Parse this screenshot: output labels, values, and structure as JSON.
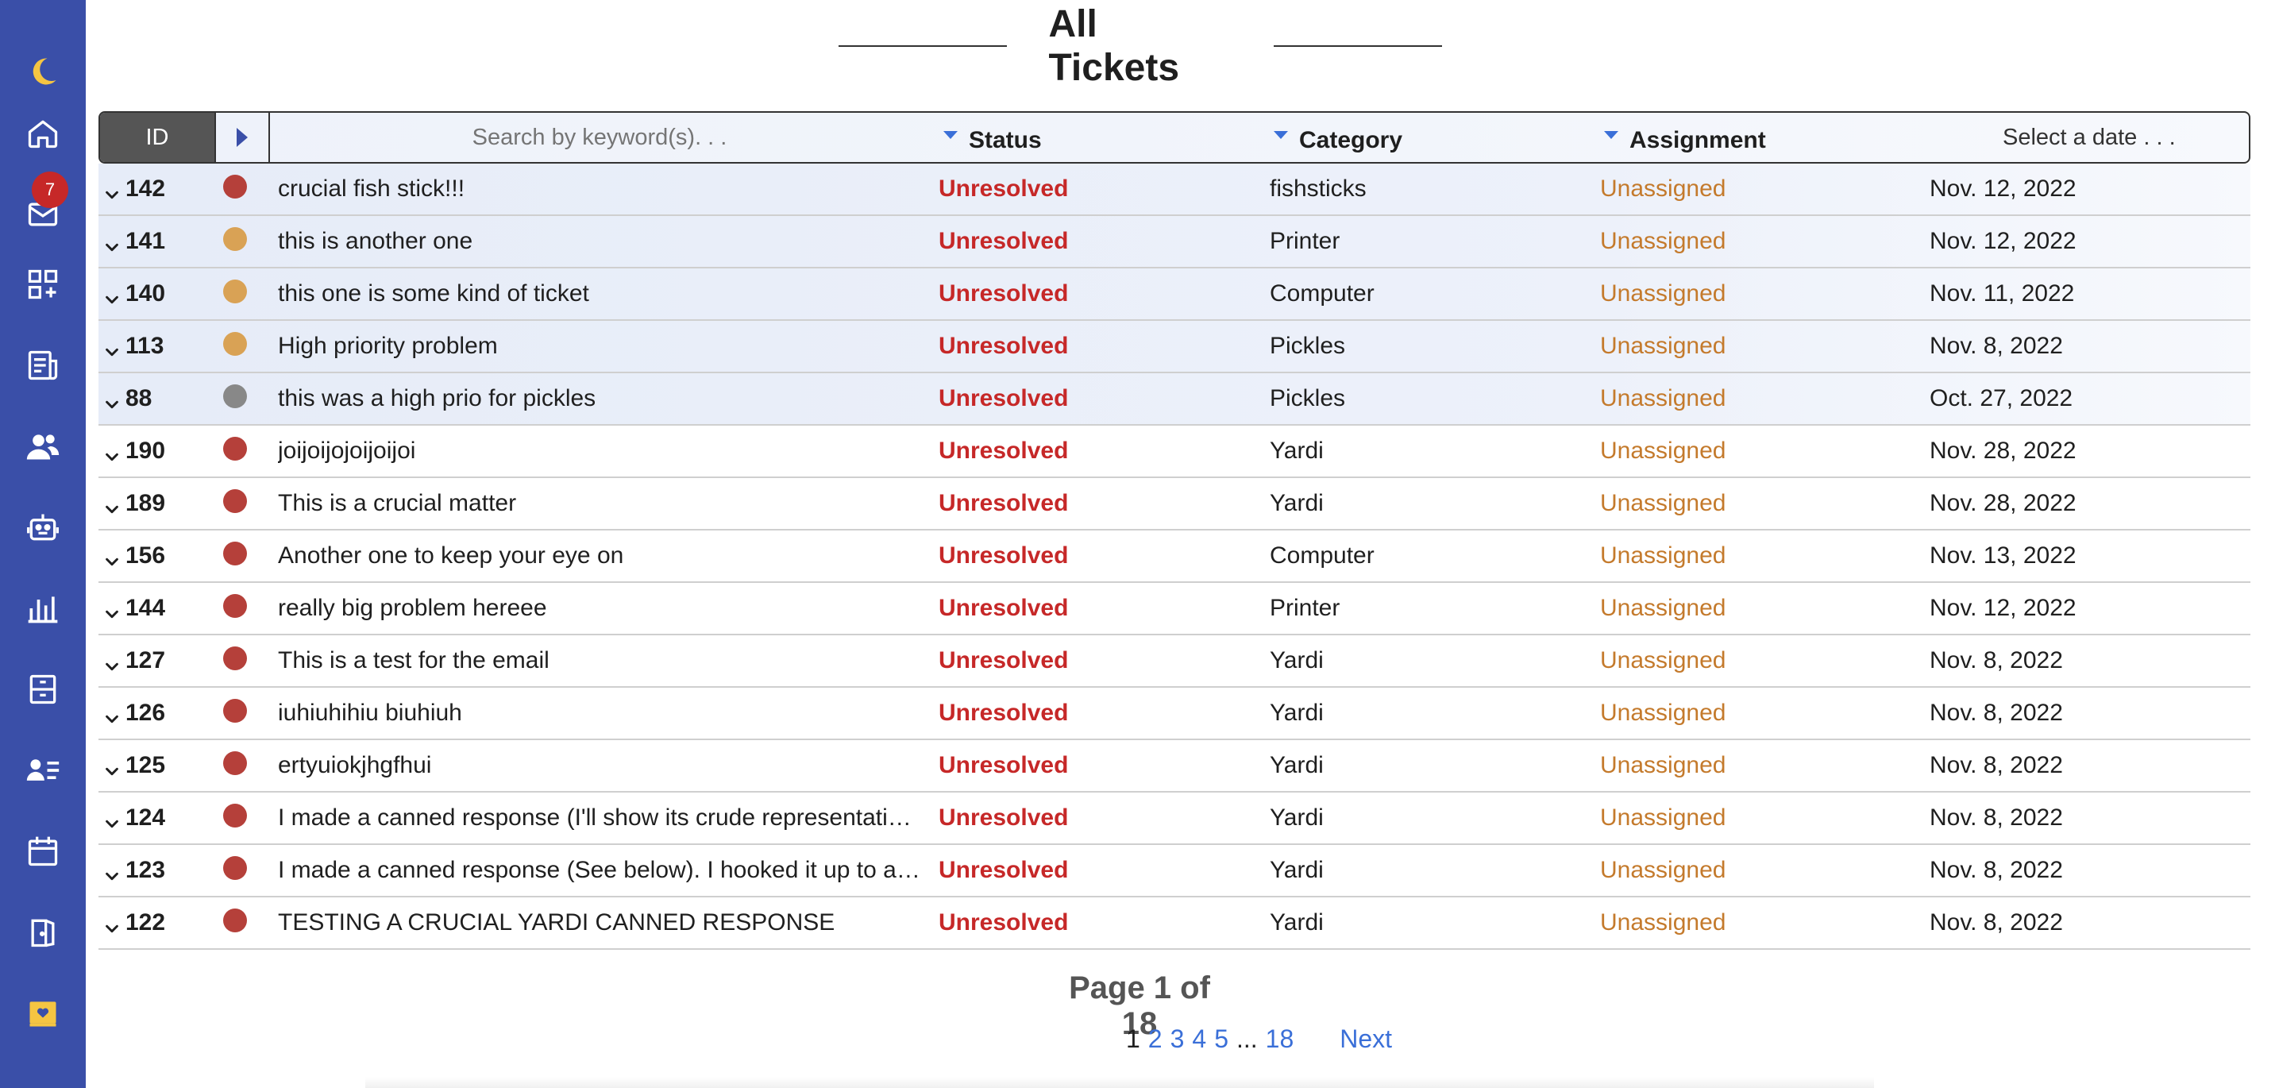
{
  "sidebar": {
    "badge_count": "7",
    "icons": [
      "moon-icon",
      "home-icon",
      "mail-icon",
      "dashboard-add-icon",
      "report-icon",
      "users-icon",
      "robot-icon",
      "chart-icon",
      "archive-icon",
      "contacts-icon",
      "calendar-icon",
      "door-icon",
      "heart-card-icon"
    ],
    "accent": "#3a4fa8"
  },
  "header": {
    "title": "All Tickets"
  },
  "table": {
    "columns": {
      "id": "ID",
      "search_placeholder": "Search by keyword(s). . .",
      "status": "Status",
      "category": "Category",
      "assignment": "Assignment",
      "date": "Select a date . . ."
    },
    "rows": [
      {
        "id": "142",
        "priority": "red",
        "title": "crucial fish stick!!!",
        "status": "Unresolved",
        "category": "fishsticks",
        "assignment": "Unassigned",
        "date": "Nov. 12, 2022",
        "highlight": true
      },
      {
        "id": "141",
        "priority": "orange",
        "title": "this is another one",
        "status": "Unresolved",
        "category": "Printer",
        "assignment": "Unassigned",
        "date": "Nov. 12, 2022",
        "highlight": true
      },
      {
        "id": "140",
        "priority": "orange",
        "title": "this one is some kind of ticket",
        "status": "Unresolved",
        "category": "Computer",
        "assignment": "Unassigned",
        "date": "Nov. 11, 2022",
        "highlight": true
      },
      {
        "id": "113",
        "priority": "orange",
        "title": "High priority problem",
        "status": "Unresolved",
        "category": "Pickles",
        "assignment": "Unassigned",
        "date": "Nov. 8, 2022",
        "highlight": true
      },
      {
        "id": "88",
        "priority": "gray",
        "title": "this was a high prio for pickles",
        "status": "Unresolved",
        "category": "Pickles",
        "assignment": "Unassigned",
        "date": "Oct. 27, 2022",
        "highlight": true
      },
      {
        "id": "190",
        "priority": "red",
        "title": "joijoijojoijoijoi",
        "status": "Unresolved",
        "category": "Yardi",
        "assignment": "Unassigned",
        "date": "Nov. 28, 2022",
        "highlight": false
      },
      {
        "id": "189",
        "priority": "red",
        "title": "This is a crucial matter",
        "status": "Unresolved",
        "category": "Yardi",
        "assignment": "Unassigned",
        "date": "Nov. 28, 2022",
        "highlight": false
      },
      {
        "id": "156",
        "priority": "red",
        "title": "Another one to keep your eye on",
        "status": "Unresolved",
        "category": "Computer",
        "assignment": "Unassigned",
        "date": "Nov. 13, 2022",
        "highlight": false
      },
      {
        "id": "144",
        "priority": "red",
        "title": "really big problem hereee",
        "status": "Unresolved",
        "category": "Printer",
        "assignment": "Unassigned",
        "date": "Nov. 12, 2022",
        "highlight": false
      },
      {
        "id": "127",
        "priority": "red",
        "title": "This is a test for the email",
        "status": "Unresolved",
        "category": "Yardi",
        "assignment": "Unassigned",
        "date": "Nov. 8, 2022",
        "highlight": false
      },
      {
        "id": "126",
        "priority": "red",
        "title": "iuhiuhihiu biuhiuh",
        "status": "Unresolved",
        "category": "Yardi",
        "assignment": "Unassigned",
        "date": "Nov. 8, 2022",
        "highlight": false
      },
      {
        "id": "125",
        "priority": "red",
        "title": "ertyuiokjhgfhui",
        "status": "Unresolved",
        "category": "Yardi",
        "assignment": "Unassigned",
        "date": "Nov. 8, 2022",
        "highlight": false
      },
      {
        "id": "124",
        "priority": "red",
        "title": "I made a canned response (I'll show its crude representati…",
        "status": "Unresolved",
        "category": "Yardi",
        "assignment": "Unassigned",
        "date": "Nov. 8, 2022",
        "highlight": false
      },
      {
        "id": "123",
        "priority": "red",
        "title": "I made a canned response (See below). I hooked it up to a …",
        "status": "Unresolved",
        "category": "Yardi",
        "assignment": "Unassigned",
        "date": "Nov. 8, 2022",
        "highlight": false
      },
      {
        "id": "122",
        "priority": "red",
        "title": "TESTING A CRUCIAL YARDI CANNED RESPONSE",
        "status": "Unresolved",
        "category": "Yardi",
        "assignment": "Unassigned",
        "date": "Nov. 8, 2022",
        "highlight": false
      }
    ]
  },
  "colors": {
    "priority_red": "#b5403a",
    "priority_orange": "#d9a255",
    "priority_gray": "#888888",
    "status": "#c62828",
    "assignment": "#c47a2c",
    "link": "#3a6fd8"
  },
  "pagination": {
    "label": "Page 1 of 18",
    "current": "1",
    "pages": [
      "2",
      "3",
      "4",
      "5"
    ],
    "ellipsis": "...",
    "last": "18",
    "next": "Next"
  }
}
